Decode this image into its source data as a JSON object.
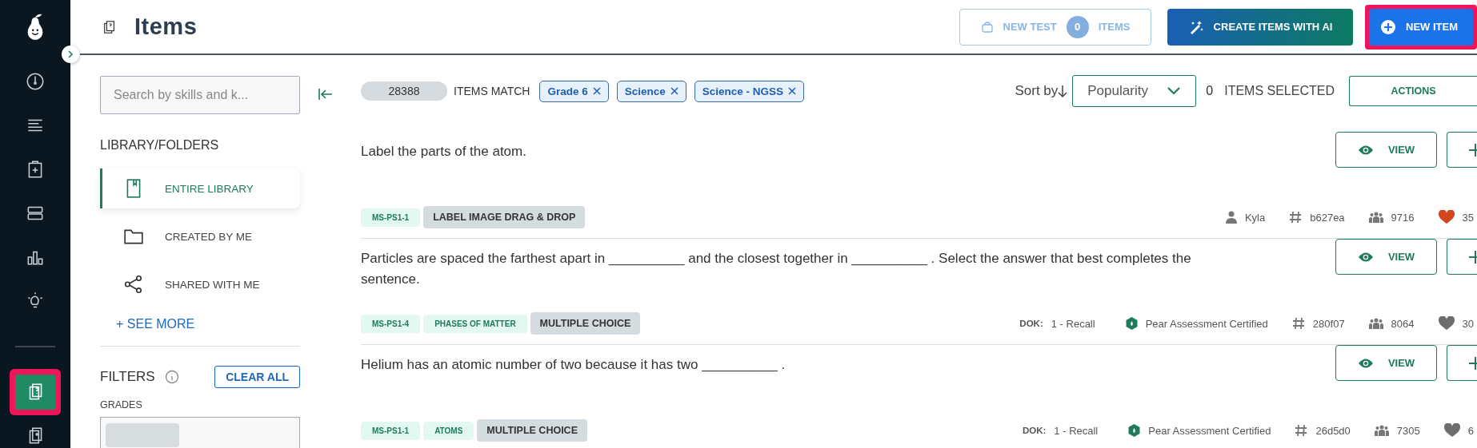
{
  "nav": [
    {
      "kind": "gauge",
      "selected": false,
      "highlighted": false
    },
    {
      "kind": "lines",
      "selected": false,
      "highlighted": false
    },
    {
      "kind": "clipboard",
      "selected": false,
      "highlighted": false
    },
    {
      "kind": "rows",
      "selected": false,
      "highlighted": false
    },
    {
      "kind": "chart",
      "selected": false,
      "highlighted": false
    },
    {
      "kind": "bulb",
      "selected": false,
      "highlighted": false
    },
    {
      "kind": "items",
      "selected": true,
      "highlighted": true
    },
    {
      "kind": "doc",
      "selected": false,
      "highlighted": false
    }
  ],
  "header": {
    "title": "Items",
    "buttons": [
      {
        "kind": "newtest",
        "label": "NEW TEST",
        "count": "0",
        "suffix": "ITEMS",
        "disabled": true,
        "highlighted": false
      },
      {
        "kind": "ai",
        "label": "CREATE ITEMS WITH AI",
        "disabled": false,
        "highlighted": false
      },
      {
        "kind": "new",
        "label": "NEW ITEM",
        "disabled": false,
        "highlighted": true
      }
    ]
  },
  "sidebar": {
    "search": {
      "placeholder": "Search by skills and k..."
    },
    "section_title": "LIBRARY/FOLDERS",
    "folders": [
      {
        "kind": "book",
        "label": "ENTIRE LIBRARY",
        "selected": true
      },
      {
        "kind": "folder",
        "label": "CREATED BY ME",
        "selected": false
      },
      {
        "kind": "share",
        "label": "SHARED WITH ME",
        "selected": false
      }
    ],
    "see_more": "+ SEE MORE",
    "filters": {
      "title": "FILTERS",
      "clear": "CLEAR ALL",
      "grades_label": "GRADES"
    }
  },
  "toolbar": {
    "count": "28388",
    "match_label": "ITEMS MATCH",
    "chips": [
      {
        "label": "Grade 6"
      },
      {
        "label": "Science"
      },
      {
        "label": "Science - NGSS"
      }
    ],
    "sort_label": "Sort by",
    "sort_value": "Popularity",
    "selected_count": "0",
    "selected_label": "ITEMS SELECTED",
    "actions": "ACTIONS"
  },
  "items": [
    {
      "question": "Label the parts of the atom.",
      "tags": [
        {
          "kind": "standard",
          "label": "MS-PS1-1"
        },
        {
          "kind": "type",
          "label": "LABEL IMAGE DRAG & DROP"
        }
      ],
      "view": "VIEW",
      "meta": [
        {
          "kind": "author",
          "text": "Kyla"
        },
        {
          "kind": "id",
          "text": "b627ea"
        },
        {
          "kind": "usage",
          "text": "9716"
        },
        {
          "kind": "likes",
          "text": "35",
          "liked": true
        }
      ]
    },
    {
      "question": "Particles are spaced the farthest apart in __________  and the closest together in __________ . Select the answer that best completes the sentence.",
      "tags": [
        {
          "kind": "standard",
          "label": "MS-PS1-4"
        },
        {
          "kind": "topic",
          "label": "PHASES OF MATTER"
        },
        {
          "kind": "type",
          "label": "MULTIPLE CHOICE"
        }
      ],
      "view": "VIEW",
      "meta": [
        {
          "kind": "dok",
          "label": "DOK:",
          "text": "1 - Recall"
        },
        {
          "kind": "certified",
          "text": "Pear Assessment Certified"
        },
        {
          "kind": "id",
          "text": "280f07"
        },
        {
          "kind": "usage",
          "text": "8064"
        },
        {
          "kind": "likes",
          "text": "30",
          "liked": false
        }
      ]
    },
    {
      "question": "Helium has an atomic number of two because it has two __________ .",
      "tags": [
        {
          "kind": "standard",
          "label": "MS-PS1-1"
        },
        {
          "kind": "topic",
          "label": "ATOMS"
        },
        {
          "kind": "type",
          "label": "MULTIPLE CHOICE"
        }
      ],
      "view": "VIEW",
      "meta": [
        {
          "kind": "dok",
          "label": "DOK:",
          "text": "1 - Recall"
        },
        {
          "kind": "certified",
          "text": "Pear Assessment Certified"
        },
        {
          "kind": "id",
          "text": "26d5d0"
        },
        {
          "kind": "usage",
          "text": "7305"
        },
        {
          "kind": "likes",
          "text": "6",
          "liked": false
        }
      ]
    }
  ]
}
